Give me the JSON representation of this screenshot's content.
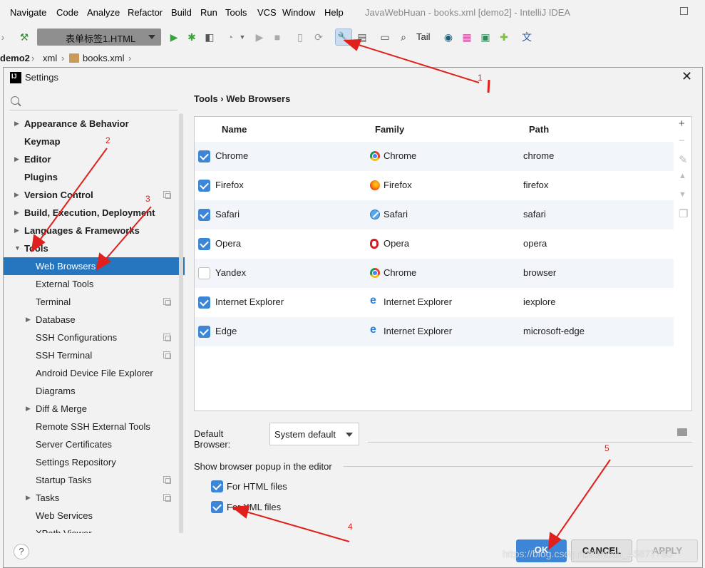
{
  "menubar": {
    "items": [
      "Navigate",
      "Code",
      "Analyze",
      "Refactor",
      "Build",
      "Run",
      "Tools",
      "VCS",
      "Window",
      "Help"
    ],
    "window_title": "JavaWebHuan - books.xml [demo2] - IntelliJ IDEA"
  },
  "toolbar": {
    "run_config": "表单标签1.HTML",
    "tail_label": "Tail"
  },
  "breadcrumbs": [
    "demo2",
    "xml",
    "books.xml"
  ],
  "dialog": {
    "title": "Settings",
    "crumb": "Tools  ›  Web Browsers",
    "tree": [
      {
        "label": "Appearance & Behavior",
        "bold": true,
        "arrow": "right",
        "level": 0
      },
      {
        "label": "Keymap",
        "bold": true,
        "arrow": "",
        "level": 0
      },
      {
        "label": "Editor",
        "bold": true,
        "arrow": "right",
        "level": 0
      },
      {
        "label": "Plugins",
        "bold": true,
        "arrow": "",
        "level": 0
      },
      {
        "label": "Version Control",
        "bold": true,
        "arrow": "right",
        "level": 0,
        "proj": true
      },
      {
        "label": "Build, Execution, Deployment",
        "bold": true,
        "arrow": "right",
        "level": 0
      },
      {
        "label": "Languages & Frameworks",
        "bold": true,
        "arrow": "right",
        "level": 0
      },
      {
        "label": "Tools",
        "bold": true,
        "arrow": "down",
        "level": 0
      },
      {
        "label": "Web Browsers",
        "bold": false,
        "arrow": "",
        "level": 1,
        "selected": true
      },
      {
        "label": "External Tools",
        "bold": false,
        "arrow": "",
        "level": 1
      },
      {
        "label": "Terminal",
        "bold": false,
        "arrow": "",
        "level": 1,
        "proj": true
      },
      {
        "label": "Database",
        "bold": false,
        "arrow": "right",
        "level": 1
      },
      {
        "label": "SSH Configurations",
        "bold": false,
        "arrow": "",
        "level": 1,
        "proj": true
      },
      {
        "label": "SSH Terminal",
        "bold": false,
        "arrow": "",
        "level": 1,
        "proj": true
      },
      {
        "label": "Android Device File Explorer",
        "bold": false,
        "arrow": "",
        "level": 1
      },
      {
        "label": "Diagrams",
        "bold": false,
        "arrow": "",
        "level": 1
      },
      {
        "label": "Diff & Merge",
        "bold": false,
        "arrow": "right",
        "level": 1
      },
      {
        "label": "Remote SSH External Tools",
        "bold": false,
        "arrow": "",
        "level": 1
      },
      {
        "label": "Server Certificates",
        "bold": false,
        "arrow": "",
        "level": 1
      },
      {
        "label": "Settings Repository",
        "bold": false,
        "arrow": "",
        "level": 1
      },
      {
        "label": "Startup Tasks",
        "bold": false,
        "arrow": "",
        "level": 1,
        "proj": true
      },
      {
        "label": "Tasks",
        "bold": false,
        "arrow": "right",
        "level": 1,
        "proj": true
      },
      {
        "label": "Web Services",
        "bold": false,
        "arrow": "",
        "level": 1
      },
      {
        "label": "XPath Viewer",
        "bold": false,
        "arrow": "",
        "level": 1
      }
    ],
    "table": {
      "headers": [
        "Name",
        "Family",
        "Path"
      ],
      "rows": [
        {
          "checked": true,
          "name": "Chrome",
          "family": "Chrome",
          "family_icon": "chrome",
          "path": "chrome"
        },
        {
          "checked": true,
          "name": "Firefox",
          "family": "Firefox",
          "family_icon": "firefox",
          "path": "firefox"
        },
        {
          "checked": true,
          "name": "Safari",
          "family": "Safari",
          "family_icon": "safari",
          "path": "safari"
        },
        {
          "checked": true,
          "name": "Opera",
          "family": "Opera",
          "family_icon": "opera",
          "path": "opera"
        },
        {
          "checked": false,
          "name": "Yandex",
          "family": "Chrome",
          "family_icon": "chrome",
          "path": "browser"
        },
        {
          "checked": true,
          "name": "Internet Explorer",
          "family": "Internet Explorer",
          "family_icon": "ie",
          "path": "iexplore"
        },
        {
          "checked": true,
          "name": "Edge",
          "family": "Internet Explorer",
          "family_icon": "ie",
          "path": "microsoft-edge"
        }
      ]
    },
    "default_browser_label": "Default Browser:",
    "default_browser_value": "System default",
    "popup_title": "Show browser popup in the editor",
    "popup_options": [
      {
        "label": "For HTML files",
        "checked": true
      },
      {
        "label": "For XML files",
        "checked": true
      }
    ],
    "buttons": {
      "ok": "OK",
      "cancel": "CANCEL",
      "apply": "APPLY"
    },
    "help_label": "?"
  },
  "watermark": "https://blog.csdn.net/weixin_45877760",
  "annotations": [
    "1",
    "2",
    "3",
    "4",
    "5"
  ],
  "colors": {
    "accent": "#2675bf",
    "checkbox": "#3d85d6",
    "annotation": "#e0201c"
  }
}
